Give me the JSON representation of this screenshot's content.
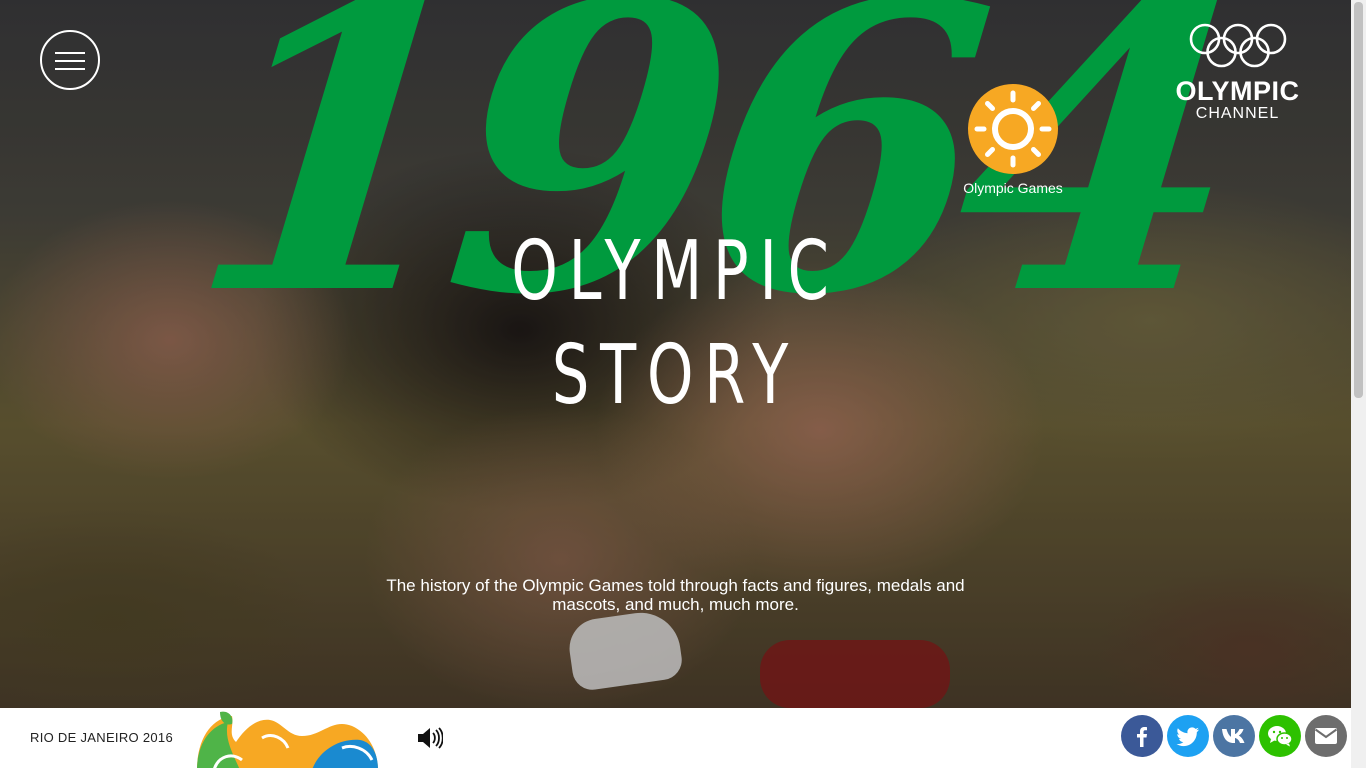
{
  "hero": {
    "year": "1964",
    "title_line1": "OLYMPIC",
    "title_line2": "STORY",
    "subtitle": "The history of the Olympic Games told through facts and figures, medals and mascots, and much, much more."
  },
  "header": {
    "menu_icon": "hamburger-menu-icon",
    "games_badge": {
      "label": "Olympic Games",
      "icon": "sun-icon",
      "color": "#f7a823"
    },
    "logo": {
      "line1": "OLYMPIC",
      "line2": "CHANNEL",
      "icon": "olympic-rings-icon"
    }
  },
  "footer": {
    "edition": "RIO DE JANEIRO 2016",
    "sound_icon": "speaker-volume-icon",
    "share": [
      {
        "name": "facebook",
        "icon": "facebook-icon",
        "color": "#3b5998"
      },
      {
        "name": "twitter",
        "icon": "twitter-icon",
        "color": "#1da1f2"
      },
      {
        "name": "vk",
        "icon": "vk-icon",
        "color": "#4c75a3"
      },
      {
        "name": "wechat",
        "icon": "wechat-icon",
        "color": "#2dc100"
      },
      {
        "name": "email",
        "icon": "email-icon",
        "color": "#6d6d6d"
      }
    ]
  },
  "colors": {
    "year_green": "#009a3e",
    "accent_orange": "#f7a823"
  }
}
